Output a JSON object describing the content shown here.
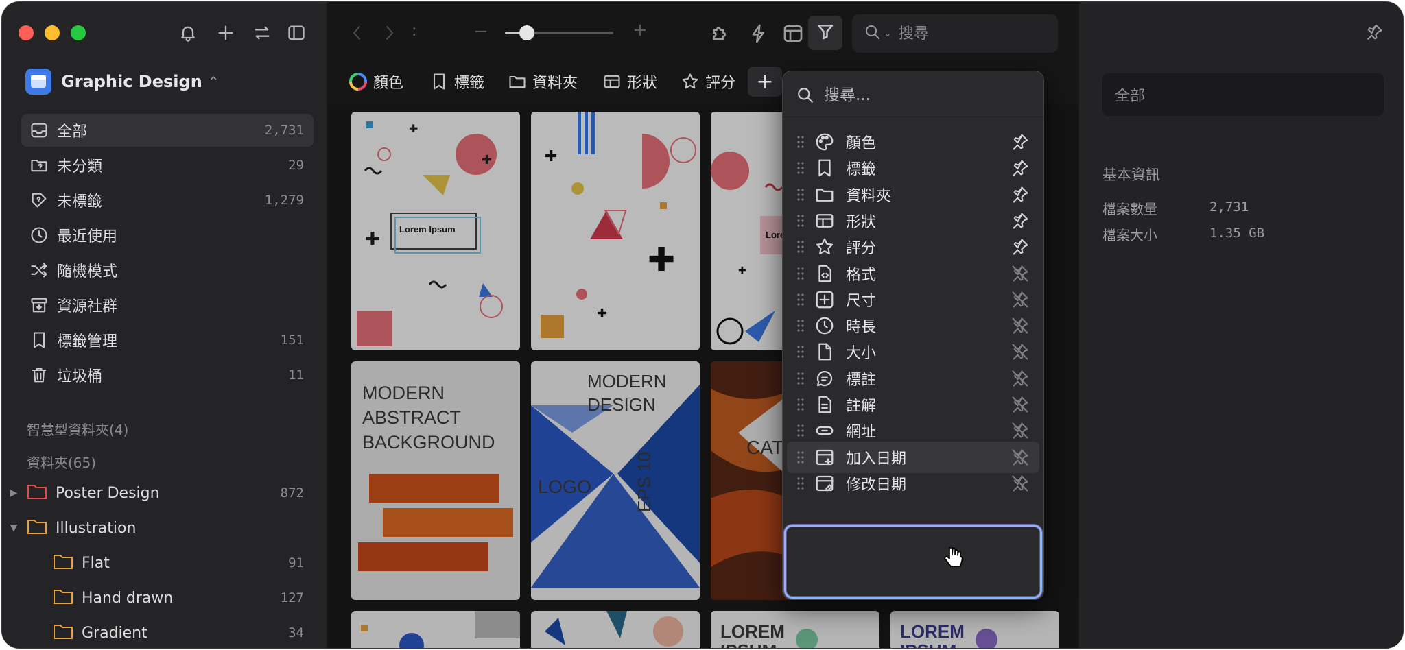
{
  "colors": {
    "accent": "#3d7ae6",
    "folder_red": "#e64a4a",
    "folder_orange": "#e8a13a",
    "highlight": "#8fb4f5"
  },
  "sidebar": {
    "library_name": "Graphic Design",
    "nav": [
      {
        "label": "全部",
        "count": "2,731",
        "icon": "inbox-icon"
      },
      {
        "label": "未分類",
        "count": "29",
        "icon": "folder-question-icon"
      },
      {
        "label": "未標籤",
        "count": "1,279",
        "icon": "tag-question-icon"
      },
      {
        "label": "最近使用",
        "count": "",
        "icon": "clock-icon"
      },
      {
        "label": "隨機模式",
        "count": "",
        "icon": "shuffle-icon"
      },
      {
        "label": "資源社群",
        "count": "",
        "icon": "archive-icon"
      },
      {
        "label": "標籤管理",
        "count": "151",
        "icon": "bookmark-icon"
      },
      {
        "label": "垃圾桶",
        "count": "11",
        "icon": "trash-icon"
      }
    ],
    "smart_folders_header": "智慧型資料夾(4)",
    "folders_header": "資料夾(65)",
    "folders": [
      {
        "label": "Poster Design",
        "count": "872"
      },
      {
        "label": "Illustration",
        "count": ""
      },
      {
        "label": "Flat",
        "count": "91"
      },
      {
        "label": "Hand drawn",
        "count": "127"
      },
      {
        "label": "Gradient",
        "count": "34"
      }
    ]
  },
  "toolbar": {
    "search_placeholder": "搜尋",
    "filters": [
      "顏色",
      "標籤",
      "資料夾",
      "形狀",
      "評分"
    ],
    "zoom_level": 0.2
  },
  "cards": {
    "card1_text": "Lorem Ipsum",
    "card3_text": "Lore",
    "card4_text": "MODERN ABSTRACT BACKGROUND",
    "card5_title": "MODERN DESIGN",
    "card5_logo": "LOGO",
    "card5_eps": "EPS 10",
    "card6_text": "CAT",
    "card7_text": "LOREM IPSUM",
    "card8_text": "LOREM IPSUM"
  },
  "dropdown": {
    "search_placeholder": "搜尋...",
    "items": [
      {
        "label": "顏色",
        "pinned": true
      },
      {
        "label": "標籤",
        "pinned": true
      },
      {
        "label": "資料夾",
        "pinned": true
      },
      {
        "label": "形狀",
        "pinned": true
      },
      {
        "label": "評分",
        "pinned": true
      },
      {
        "label": "格式",
        "pinned": false
      },
      {
        "label": "尺寸",
        "pinned": false
      },
      {
        "label": "時長",
        "pinned": false
      },
      {
        "label": "大小",
        "pinned": false
      },
      {
        "label": "標註",
        "pinned": false
      },
      {
        "label": "註解",
        "pinned": false
      },
      {
        "label": "網址",
        "pinned": false
      },
      {
        "label": "加入日期",
        "pinned": false
      },
      {
        "label": "修改日期",
        "pinned": false
      }
    ]
  },
  "inspector": {
    "field_value": "全部",
    "section_title": "基本資訊",
    "rows": [
      {
        "label": "檔案數量",
        "value": "2,731"
      },
      {
        "label": "檔案大小",
        "value": "1.35 GB"
      }
    ]
  }
}
